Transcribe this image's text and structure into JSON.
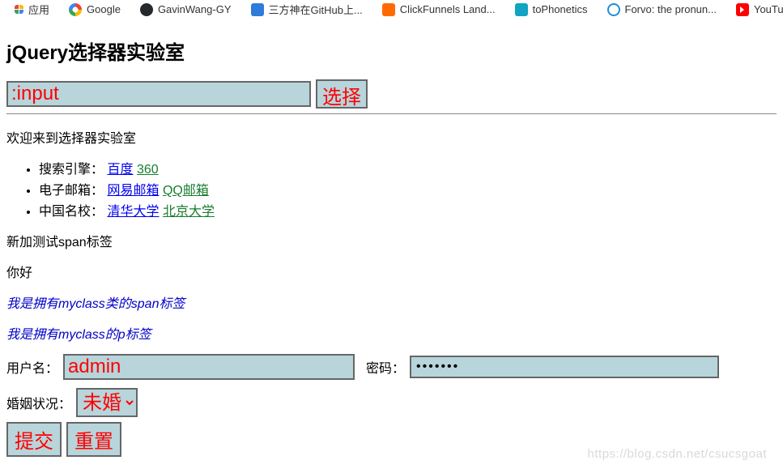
{
  "bookmarks": {
    "apps": "应用",
    "google": "Google",
    "github": "GavinWang-GY",
    "sanfang": "三方神在GitHub上...",
    "clickfunnels": "ClickFunnels Land...",
    "tophonetics": "toPhonetics",
    "forvo": "Forvo: the pronun...",
    "youtube": "YouTube Down..."
  },
  "title": "jQuery选择器实验室",
  "selector": {
    "input_value": ":input",
    "button_label": "选择"
  },
  "welcome": "欢迎来到选择器实验室",
  "list": {
    "item1_label": "搜索引擎：",
    "item1_link1": "百度",
    "item1_link2": "360",
    "item2_label": "电子邮箱：",
    "item2_link1": "网易邮箱",
    "item2_link2": "QQ邮箱",
    "item3_label": "中国名校：",
    "item3_link1": "清华大学",
    "item3_link2": "北京大学"
  },
  "new_span": "新加测试span标签",
  "hello": "你好",
  "myclass_span": "我是拥有myclass类的span标签",
  "myclass_p": "我是拥有myclass的p标签",
  "form": {
    "user_label": "用户名：",
    "user_value": "admin",
    "pass_label": "密码：",
    "pass_value": "•••••••",
    "marital_label": "婚姻状况：",
    "marital_value": "未婚",
    "submit": "提交",
    "reset": "重置"
  },
  "watermark": "https://blog.csdn.net/csucsgoat"
}
